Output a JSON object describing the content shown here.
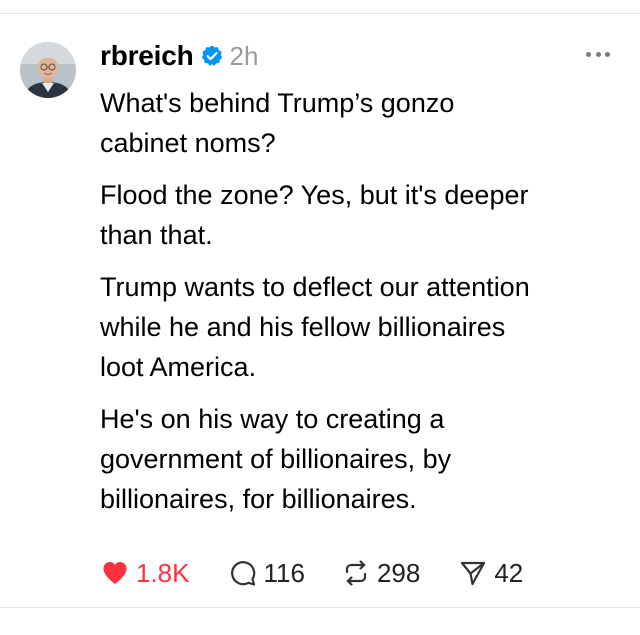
{
  "post": {
    "username": "rbreich",
    "verified": true,
    "timestamp": "2h",
    "paragraphs": [
      "What's behind Trump’s gonzo\ncabinet noms?",
      "Flood the zone? Yes, but it's deeper\nthan that.",
      "Trump wants to deflect our attention\nwhile he and his fellow billionaires\nloot America.",
      "He's on his way to creating a\ngovernment of billionaires, by\nbillionaires, for billionaires."
    ],
    "actions": {
      "likes": "1.8K",
      "replies": "116",
      "reposts": "298",
      "shares": "42"
    }
  },
  "icons": {
    "like": "heart-filled-icon",
    "reply": "speech-bubble-icon",
    "repost": "repost-arrows-icon",
    "share": "paper-plane-icon",
    "more": "more-horizontal-icon",
    "verified": "verified-badge-icon"
  },
  "colors": {
    "like": "#ff3040",
    "verified": "#0095f6",
    "timestamp": "#9a9a9a"
  }
}
